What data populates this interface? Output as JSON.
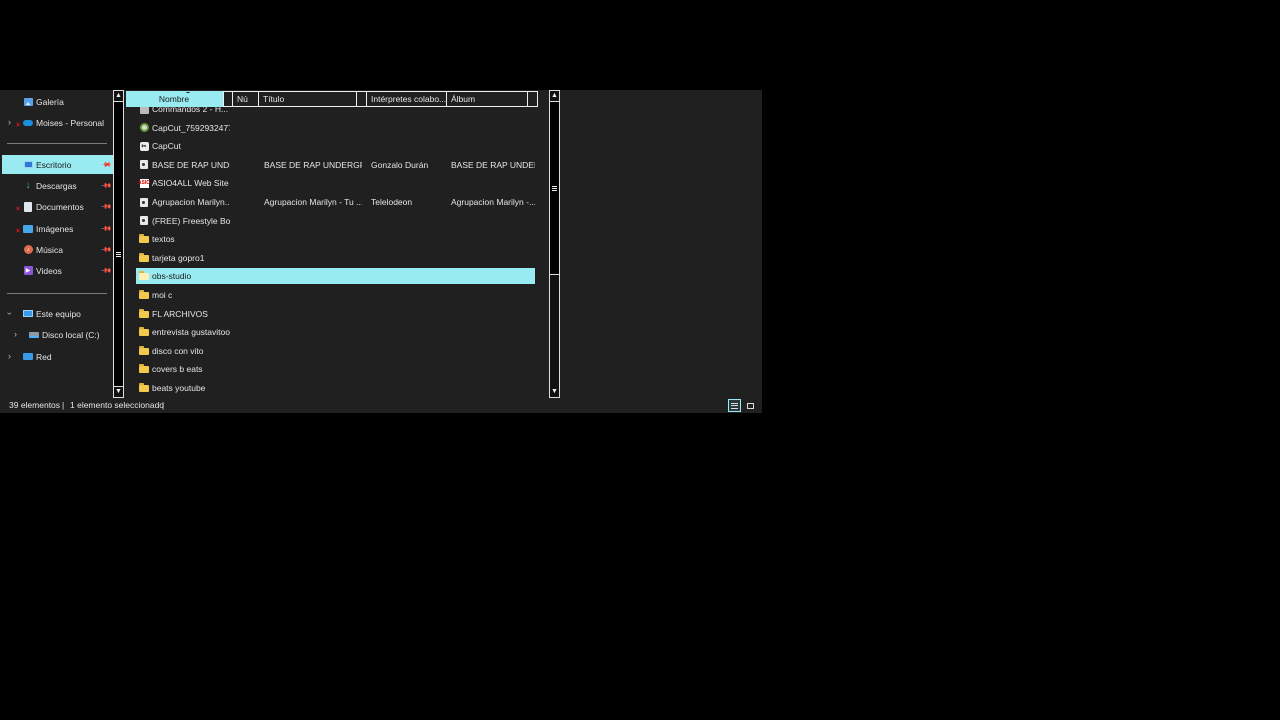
{
  "nav": {
    "quick": [
      {
        "label": "Galería",
        "icon": "gallery-icon"
      },
      {
        "label": "Moises - Personal",
        "icon": "onedrive-cloud-icon",
        "error": true
      }
    ],
    "pinned": [
      {
        "label": "Escritorio",
        "icon": "desktop-icon",
        "selected": true
      },
      {
        "label": "Descargas",
        "icon": "download-icon"
      },
      {
        "label": "Documentos",
        "icon": "documents-icon",
        "error": true
      },
      {
        "label": "Imágenes",
        "icon": "pictures-icon",
        "error": true
      },
      {
        "label": "Música",
        "icon": "music-icon"
      },
      {
        "label": "Videos",
        "icon": "videos-icon"
      }
    ],
    "this_pc": "Este equipo",
    "local_disk": "Disco local (C:)",
    "network": "Red"
  },
  "columns": {
    "name": "Nombre",
    "number": "Nú",
    "title": "Título",
    "artists": "Intérpretes colabo...",
    "album": "Álbum"
  },
  "files": [
    {
      "name": "Commandos 2 - H...",
      "icon": "app-icon",
      "title": "",
      "artists": "",
      "album": ""
    },
    {
      "name": "CapCut_7592932477...",
      "icon": "capcut-installer-icon",
      "title": "",
      "artists": "",
      "album": ""
    },
    {
      "name": "CapCut",
      "icon": "capcut-icon",
      "title": "",
      "artists": "",
      "album": ""
    },
    {
      "name": "BASE DE RAP UNDE...",
      "icon": "audio-file-icon",
      "title": "BASE DE RAP UNDERGRO...",
      "artists": "Gonzalo Durán",
      "album": "BASE DE RAP UNDER..."
    },
    {
      "name": "ASIO4ALL Web Site",
      "icon": "asio-link-icon",
      "title": "",
      "artists": "",
      "album": ""
    },
    {
      "name": "Agrupacion Marilyn...",
      "icon": "audio-file-icon",
      "title": "Agrupacion Marilyn - Tu ...",
      "artists": "Telelodeon",
      "album": "Agrupacion Marilyn -..."
    },
    {
      "name": "(FREE) Freestyle Bo...",
      "icon": "audio-file-icon",
      "title": "",
      "artists": "",
      "album": ""
    },
    {
      "name": "textos",
      "icon": "folder-icon",
      "title": "",
      "artists": "",
      "album": ""
    },
    {
      "name": "tarjeta gopro1",
      "icon": "folder-icon",
      "title": "",
      "artists": "",
      "album": ""
    },
    {
      "name": "obs-studio",
      "icon": "folder-icon",
      "selected": true,
      "title": "",
      "artists": "",
      "album": ""
    },
    {
      "name": "moi c",
      "icon": "folder-icon",
      "title": "",
      "artists": "",
      "album": ""
    },
    {
      "name": "FL ARCHIVOS",
      "icon": "folder-icon",
      "title": "",
      "artists": "",
      "album": ""
    },
    {
      "name": "entrevista gustavitoo",
      "icon": "folder-icon",
      "title": "",
      "artists": "",
      "album": ""
    },
    {
      "name": "disco con vito",
      "icon": "folder-icon",
      "title": "",
      "artists": "",
      "album": ""
    },
    {
      "name": "covers b eats",
      "icon": "folder-icon",
      "title": "",
      "artists": "",
      "album": ""
    },
    {
      "name": "beats youtube",
      "icon": "folder-icon",
      "title": "",
      "artists": "",
      "album": ""
    }
  ],
  "status": {
    "count": "39 elementos",
    "selection": "1 elemento seleccionado"
  },
  "colors": {
    "selection": "#99ebf2",
    "background": "#202020",
    "text": "#e6e6e6"
  }
}
